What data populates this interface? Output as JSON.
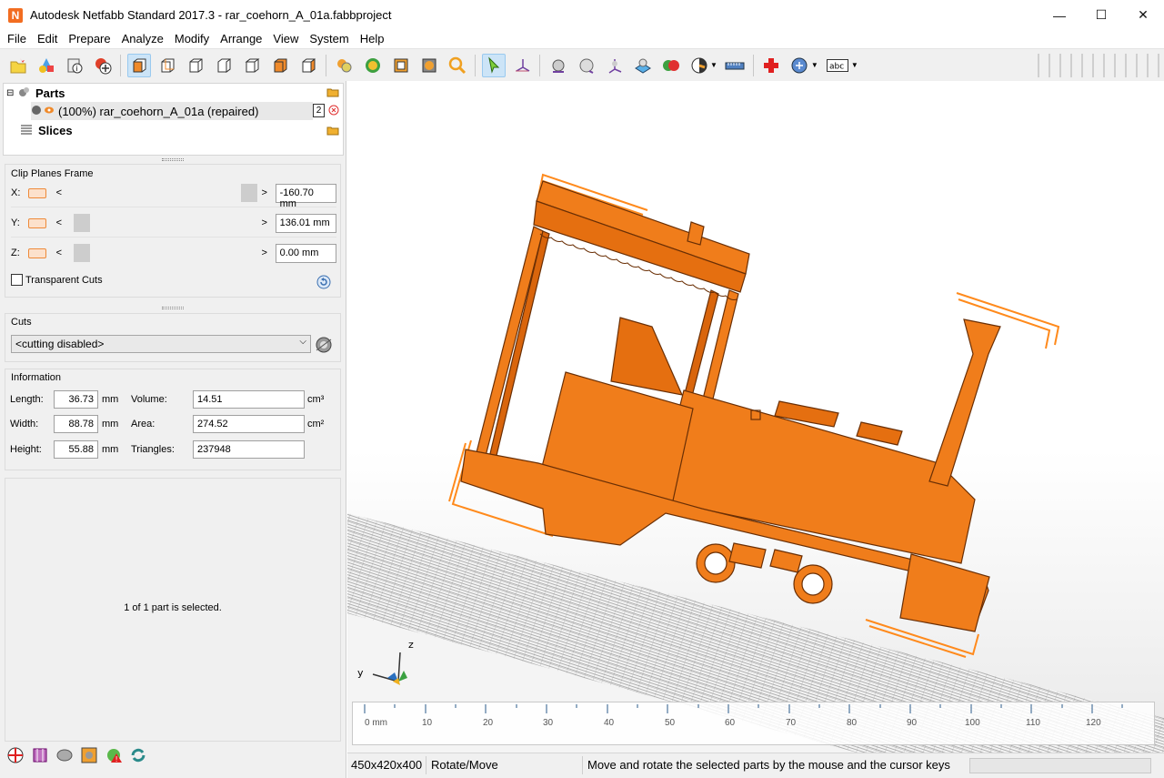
{
  "window": {
    "title": "Autodesk Netfabb Standard 2017.3 - rar_coehorn_A_01a.fabbproject",
    "app_icon_letter": "N",
    "minimize_glyph": "—",
    "maximize_glyph": "☐",
    "close_glyph": "✕"
  },
  "menu": [
    "File",
    "Edit",
    "Prepare",
    "Analyze",
    "Modify",
    "Arrange",
    "View",
    "System",
    "Help"
  ],
  "tree": {
    "parts_label": "Parts",
    "part_item": "(100%) rar_coehorn_A_01a (repaired)",
    "part_badge": "2",
    "slices_label": "Slices"
  },
  "clip_planes": {
    "title": "Clip Planes Frame",
    "x_label": "X:",
    "y_label": "Y:",
    "z_label": "Z:",
    "x_value": "-160.70 mm",
    "y_value": "136.01 mm",
    "z_value": "0.00 mm",
    "arrow_left": "<",
    "arrow_right": ">",
    "transparent_cuts": "Transparent Cuts"
  },
  "cuts": {
    "title": "Cuts",
    "selected": "<cutting disabled>"
  },
  "information": {
    "title": "Information",
    "length_label": "Length:",
    "length_value": "36.73",
    "width_label": "Width:",
    "width_value": "88.78",
    "height_label": "Height:",
    "height_value": "55.88",
    "unit_mm": "mm",
    "volume_label": "Volume:",
    "volume_value": "14.51",
    "area_label": "Area:",
    "area_value": "274.52",
    "triangles_label": "Triangles:",
    "triangles_value": "237948",
    "unit_cm3": "cm³",
    "unit_cm2": "cm²"
  },
  "selection_message": "1 of 1 part is selected.",
  "ruler": {
    "labels": [
      "0 mm",
      "10",
      "20",
      "30",
      "40",
      "50",
      "60",
      "70",
      "80",
      "90",
      "100",
      "110",
      "120"
    ]
  },
  "axis_labels": {
    "z": "z",
    "y": "y"
  },
  "status": {
    "platform_size": "450x420x400",
    "mode": "Rotate/Move",
    "hint": "Move and rotate the selected parts by the mouse and the cursor keys"
  },
  "colors": {
    "part_orange": "#f07d1b",
    "frame_orange": "#ff8a1c",
    "accent_blue": "#cce4f7"
  },
  "icons": {
    "toolbar": [
      "open-project-icon",
      "add-part-icon",
      "part-info-icon",
      "add-icon",
      "view-front-icon",
      "view-back-icon",
      "view-left-icon",
      "view-right-icon",
      "view-top-icon",
      "view-bottom-icon",
      "view-iso-icon",
      "zoom-all-icon",
      "zoom-selection-icon",
      "zoom-platform-icon",
      "zoom-part-icon",
      "zoom-icon",
      "select-icon",
      "move-icon",
      "measure-icon",
      "sphere-icon",
      "axes-icon",
      "platform-icon",
      "colors-icon",
      "shading-icon",
      "ruler-icon",
      "repair-icon",
      "labels-icon",
      "text-icon"
    ]
  }
}
